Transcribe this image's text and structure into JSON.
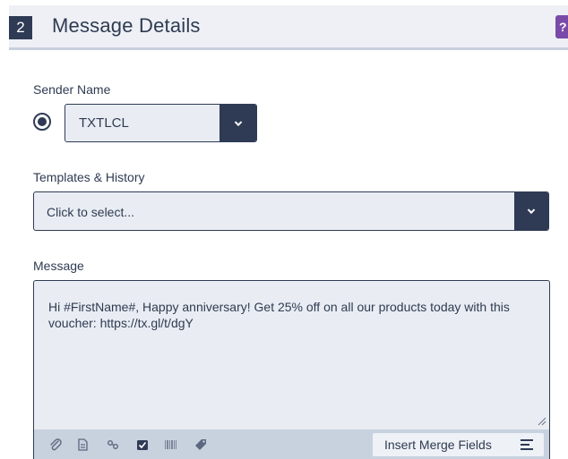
{
  "section": {
    "step_number": "2",
    "title": "Message Details",
    "help_label": "?"
  },
  "sender": {
    "label": "Sender Name",
    "selected": "TXTLCL"
  },
  "templates": {
    "label": "Templates & History",
    "placeholder": "Click to select..."
  },
  "message": {
    "label": "Message",
    "text": "Hi #FirstName#, Happy  anniversary!  Get 25% off on all our products  today with this voucher: https://tx.gl/t/dgY"
  },
  "toolbar": {
    "icons": [
      "paperclip-icon",
      "document-icon",
      "link-icon",
      "checkbox-icon",
      "barcode-icon",
      "tag-icon"
    ],
    "merge_label": "Insert Merge Fields"
  },
  "colors": {
    "accent": "#2f3b55",
    "field_bg": "#e9edf3",
    "toolbar_bg": "#c8d1de",
    "help": "#7a4aa8"
  }
}
